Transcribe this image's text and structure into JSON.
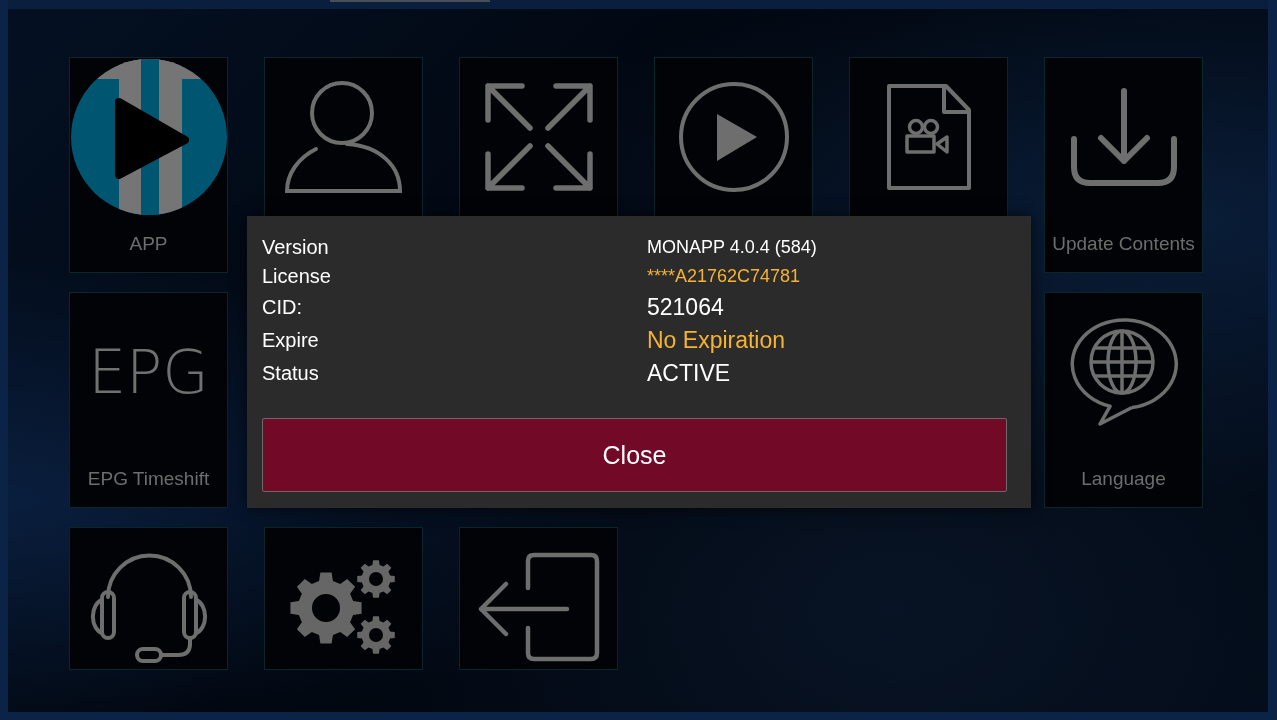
{
  "tiles": [
    {
      "label": "APP",
      "selected": false
    },
    {
      "selected": false
    },
    {
      "selected": false
    },
    {
      "selected": false
    },
    {
      "selected": false
    },
    {
      "label": "Update Contents",
      "selected": false
    },
    {
      "icon_text": "EPG",
      "label": "EPG Timeshift",
      "selected": false
    },
    {
      "label": "Language",
      "selected": false
    },
    {
      "selected": false
    },
    {
      "selected": false
    },
    {
      "selected": false
    }
  ],
  "dialog": {
    "rows": [
      {
        "label": "Version",
        "value": "MONAPP 4.0.4 (584)",
        "color": "#ffffff"
      },
      {
        "label": "License",
        "value": "****A21762C74781",
        "color": "#f6b331"
      },
      {
        "label": "CID:",
        "value": "521064",
        "color": "#ffffff"
      },
      {
        "label": "Expire",
        "value": "No Expiration",
        "color": "#f6b331"
      },
      {
        "label": "Status",
        "value": "ACTIVE",
        "color": "#ffffff"
      }
    ],
    "button": {
      "label": "Close"
    }
  }
}
